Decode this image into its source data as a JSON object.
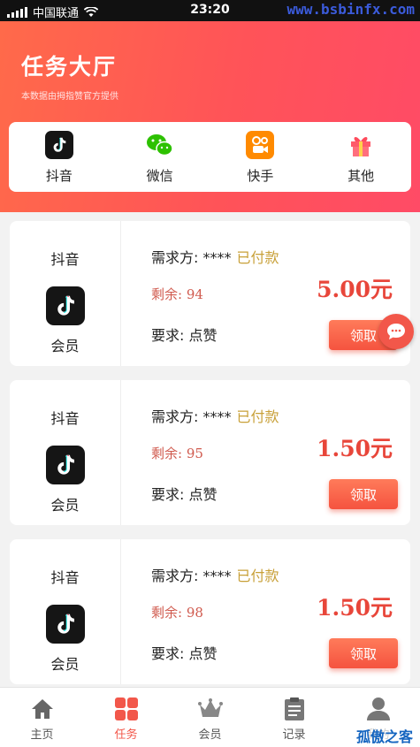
{
  "status_bar": {
    "carrier": "中国联通",
    "time": "23:20"
  },
  "watermarks": {
    "top": "www.bsbinfx.com",
    "bottom": "孤傲之客"
  },
  "header": {
    "title": "任务大厅",
    "subtitle": "本数据由拇指赞官方提供"
  },
  "categories": [
    {
      "label": "抖音",
      "icon": "tiktok-icon"
    },
    {
      "label": "微信",
      "icon": "wechat-icon"
    },
    {
      "label": "快手",
      "icon": "kuaishou-icon"
    },
    {
      "label": "其他",
      "icon": "gift-icon"
    }
  ],
  "tasks": [
    {
      "platform": "抖音",
      "level": "会员",
      "requester": "需求方: ****",
      "status": "已付款",
      "remaining": "剩余: 94",
      "price": "5.00元",
      "requirement": "要求: 点赞",
      "button": "领取"
    },
    {
      "platform": "抖音",
      "level": "会员",
      "requester": "需求方: ****",
      "status": "已付款",
      "remaining": "剩余: 95",
      "price": "1.50元",
      "requirement": "要求: 点赞",
      "button": "领取"
    },
    {
      "platform": "抖音",
      "level": "会员",
      "requester": "需求方: ****",
      "status": "已付款",
      "remaining": "剩余: 98",
      "price": "1.50元",
      "requirement": "要求: 点赞",
      "button": "领取"
    }
  ],
  "tabbar": [
    {
      "label": "主页",
      "icon": "home-icon"
    },
    {
      "label": "任务",
      "icon": "tasks-icon",
      "active": true
    },
    {
      "label": "会员",
      "icon": "crown-icon"
    },
    {
      "label": "记录",
      "icon": "clipboard-icon"
    },
    {
      "label": "我的",
      "icon": "user-icon"
    }
  ],
  "colors": {
    "accent": "#f2574a",
    "paid": "#c8a038",
    "price": "#e8463a"
  }
}
